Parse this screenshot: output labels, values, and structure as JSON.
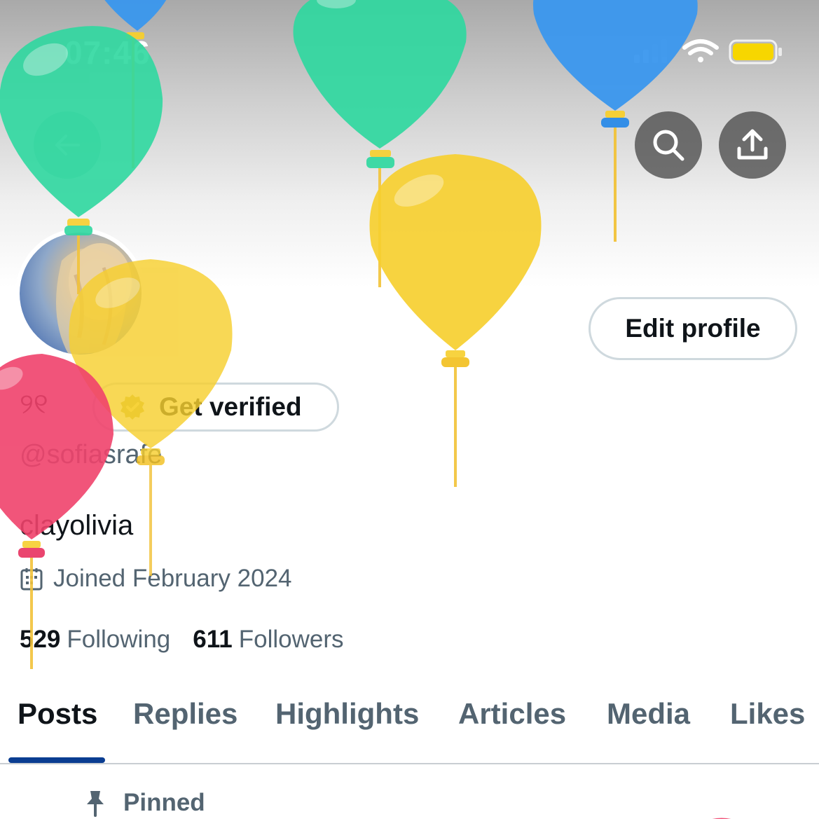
{
  "status_bar": {
    "time": "07:46"
  },
  "header": {
    "back_icon": "arrow-left-icon",
    "search_icon": "search-icon",
    "share_icon": "share-upload-icon"
  },
  "profile": {
    "edit_label": "Edit profile",
    "display_name": "୨୧",
    "verify_label": "Get verified",
    "handle": "@sofiasrafe",
    "bio": "clayolivia",
    "joined": "Joined February 2024",
    "following_count": "529",
    "following_label": "Following",
    "followers_count": "611",
    "followers_label": "Followers"
  },
  "tabs": [
    "Posts",
    "Replies",
    "Highlights",
    "Articles",
    "Media",
    "Likes"
  ],
  "active_tab": "Posts",
  "pinned_label": "Pinned",
  "colors": {
    "accent_underline": "#0a3d91",
    "balloon_green": "#2fd8a0",
    "balloon_blue": "#3a97ee",
    "balloon_yellow": "#f7cf2f",
    "balloon_pink": "#f0426c",
    "battery": "#f7d600"
  }
}
